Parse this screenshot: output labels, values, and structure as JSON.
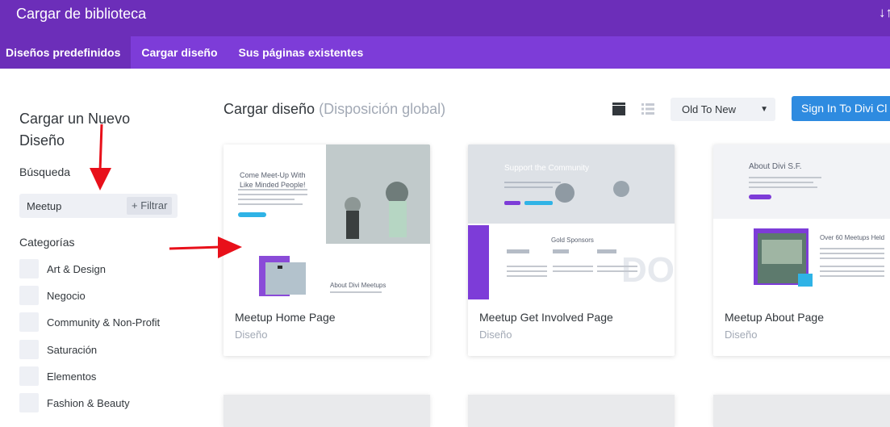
{
  "window": {
    "title": "Cargar de biblioteca",
    "sort_icon": "↓↑"
  },
  "tabs": [
    {
      "label": "Diseños predefinidos",
      "active": true
    },
    {
      "label": "Cargar diseño",
      "active": false
    },
    {
      "label": "Sus páginas existentes",
      "active": false
    }
  ],
  "sidebar": {
    "heading": "Cargar un Nuevo Diseño",
    "search_label": "Búsqueda",
    "search_value": "Meetup",
    "filter_label": "+ Filtrar",
    "categories_label": "Categorías",
    "categories": [
      "Art & Design",
      "Negocio",
      "Community & Non-Profit",
      "Saturación",
      "Elementos",
      "Fashion & Beauty"
    ]
  },
  "main": {
    "title": "Cargar diseño",
    "subtitle": "(Disposición global)",
    "sort_value": "Old To New",
    "signin_label": "Sign In To Divi Cl"
  },
  "cards": [
    {
      "name": "Meetup Home Page",
      "type": "Diseño",
      "thumb": {
        "headline": "Come Meet-Up With Like Minded People!",
        "section": "About Divi Meetups"
      }
    },
    {
      "name": "Meetup Get Involved Page",
      "type": "Diseño",
      "thumb": {
        "headline": "Support the Community",
        "section": "Gold Sponsors"
      }
    },
    {
      "name": "Meetup About Page",
      "type": "Diseño",
      "thumb": {
        "headline": "About Divi S.F.",
        "section": "Over 60 Meetups Held"
      }
    }
  ],
  "colors": {
    "titlebar": "#6c2eb9",
    "tabbar": "#7d3cd8",
    "primary_button": "#2e8be0",
    "annotation_arrow": "#e8101a"
  }
}
